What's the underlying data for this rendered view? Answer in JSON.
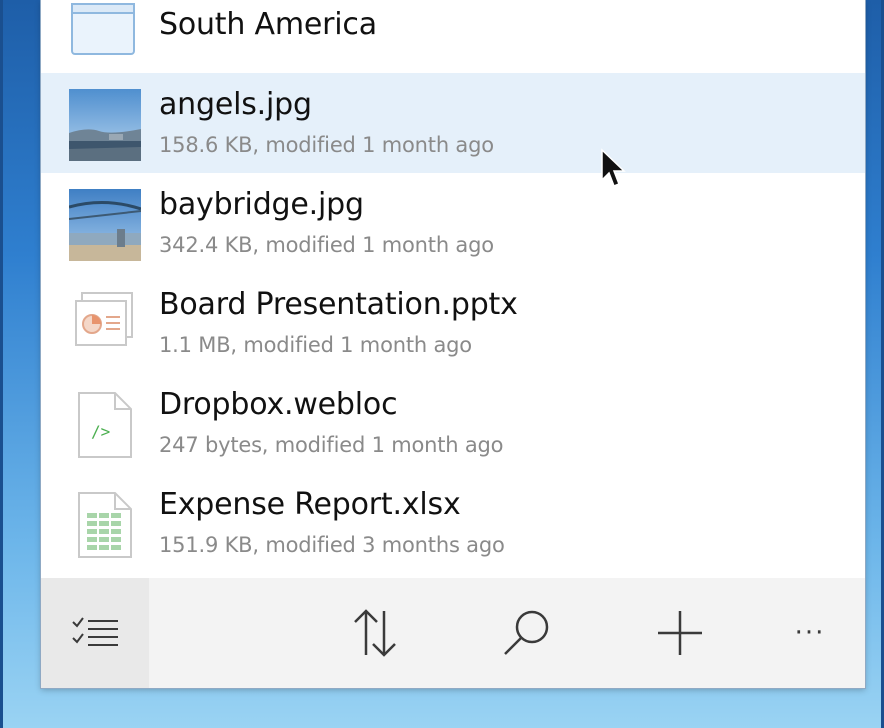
{
  "files": [
    {
      "name": "South America",
      "meta": "",
      "kind": "folder-icon"
    },
    {
      "name": "angels.jpg",
      "meta": "158.6 KB, modified 1 month ago",
      "kind": "image-thumbnail",
      "selected": true
    },
    {
      "name": "baybridge.jpg",
      "meta": "342.4 KB, modified 1 month ago",
      "kind": "image-thumbnail"
    },
    {
      "name": "Board Presentation.pptx",
      "meta": "1.1 MB, modified 1 month ago",
      "kind": "presentation-icon"
    },
    {
      "name": "Dropbox.webloc",
      "meta": "247 bytes, modified 1 month ago",
      "kind": "code-file-icon"
    },
    {
      "name": "Expense Report.xlsx",
      "meta": "151.9 KB, modified 3 months ago",
      "kind": "spreadsheet-icon"
    }
  ],
  "toolbar": {
    "select_icon": "checklist-icon",
    "sort_icon": "sort-arrows-icon",
    "search_icon": "search-icon",
    "add_icon": "plus-icon",
    "more_label": "···"
  },
  "colors": {
    "selected_row": "#e5f0fa",
    "toolbar_bg": "#f3f3f3",
    "meta_text": "#8a8a8a"
  }
}
